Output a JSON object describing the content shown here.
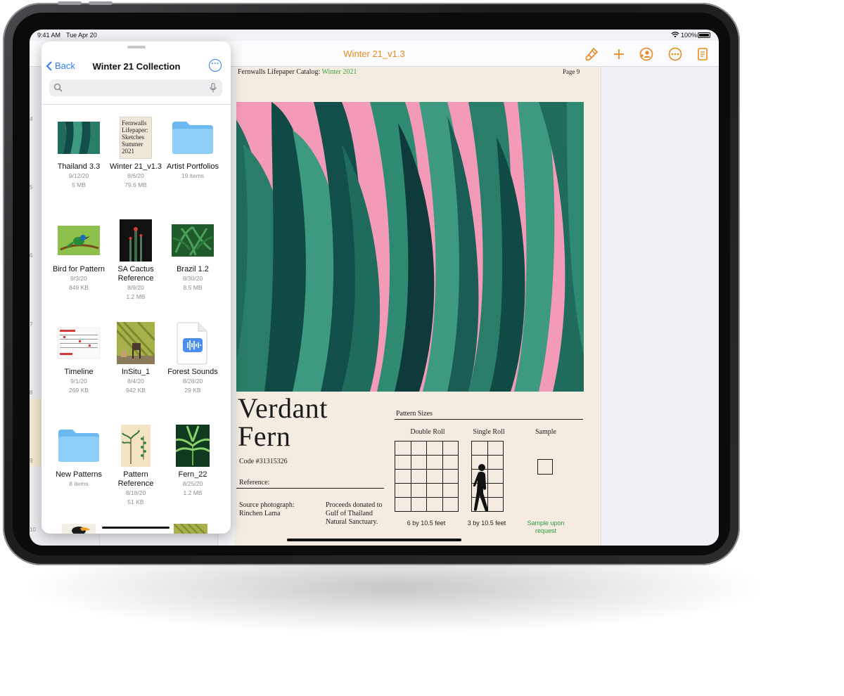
{
  "status_bar": {
    "time": "9:41 AM",
    "date": "Tue Apr 20",
    "battery": "100%"
  },
  "toolbar": {
    "doc_title": "Winter 21_v1.3",
    "accent_color": "#e8891d",
    "icons": [
      "paintbrush-icon",
      "plus-icon",
      "collaborate-icon",
      "more-icon",
      "document-icon"
    ]
  },
  "page_numbers": [
    "4",
    "5",
    "6",
    "7",
    "8",
    "9",
    "10"
  ],
  "files_panel": {
    "back_label": "Back",
    "title": "Winter 21 Collection",
    "search_placeholder": "",
    "accent_color": "#2f7df6",
    "items": [
      {
        "name": "Thailand 3.3",
        "date": "9/12/20",
        "size": "5 MB",
        "thumb": "jungle-leaves"
      },
      {
        "name": "Winter 21_v1.3",
        "date": "8/6/20",
        "size": "79.6 MB",
        "thumb": "sketch-cover",
        "cover_text": "Fernwalls Lifepaper: Sketches Summer 2021"
      },
      {
        "name": "Artist Portfolios",
        "date": "",
        "size": "19 items",
        "thumb": "folder"
      },
      {
        "name": "Bird for Pattern",
        "date": "9/3/20",
        "size": "849 KB",
        "thumb": "bird-photo"
      },
      {
        "name": "SA Cactus Reference",
        "date": "8/9/20",
        "size": "1.2 MB",
        "thumb": "cactus-photo"
      },
      {
        "name": "Brazil 1.2",
        "date": "8/30/20",
        "size": "8.5 MB",
        "thumb": "palm-pattern"
      },
      {
        "name": "Timeline",
        "date": "9/1/20",
        "size": "269 KB",
        "thumb": "calendar-sheet"
      },
      {
        "name": "InSitu_1",
        "date": "8/4/20",
        "size": "942 KB",
        "thumb": "room-photo"
      },
      {
        "name": "Forest Sounds",
        "date": "8/28/20",
        "size": "29 KB",
        "thumb": "audio-file"
      },
      {
        "name": "New Patterns",
        "date": "",
        "size": "8 items",
        "thumb": "folder"
      },
      {
        "name": "Pattern Reference",
        "date": "8/18/20",
        "size": "51 KB",
        "thumb": "botanical-print"
      },
      {
        "name": "Fern_22",
        "date": "8/25/20",
        "size": "1.2 MB",
        "thumb": "fern-photo"
      }
    ]
  },
  "document": {
    "header_prefix": "Fernwalls Lifepaper Catalog:",
    "header_accent": "Winter 2021",
    "page_label": "Page 9",
    "product_name_line1": "Verdant",
    "product_name_line2": "Fern",
    "code": "Code #31315326",
    "reference_label": "Reference:",
    "source_text": "Source photograph: Rinchen Lama",
    "proceeds_text": "Proceeds donated to Gulf of Thailand Natural Sanctuary.",
    "pattern_sizes_label": "Pattern Sizes",
    "columns": [
      {
        "label": "Double Roll",
        "dimension": "6 by 10.5 feet"
      },
      {
        "label": "Single Roll",
        "dimension": "3 by 10.5 feet"
      },
      {
        "label": "Sample",
        "dimension": "Sample upon request"
      }
    ],
    "accent_color": "#3aa640",
    "art_colors": {
      "background": "#f29ab8",
      "leaf_dark": "#0e3a3a",
      "leaf_mid": "#1f6b5c",
      "leaf_light": "#3d9a80"
    }
  }
}
